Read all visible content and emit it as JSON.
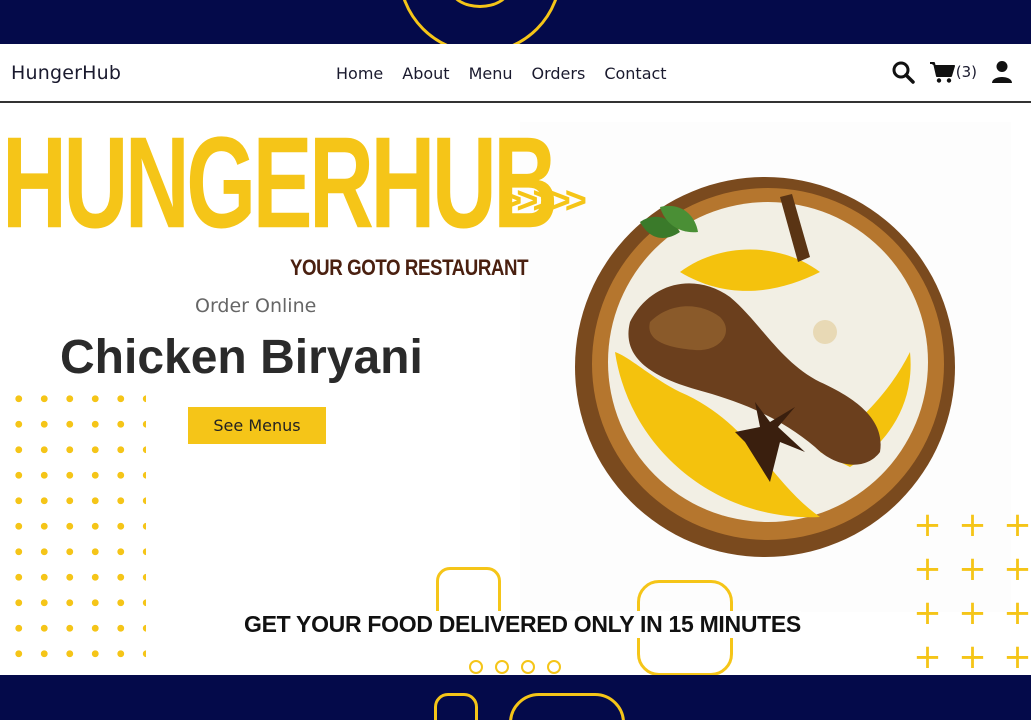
{
  "brand": "HungerHub",
  "nav": {
    "home": "Home",
    "about": "About",
    "menu": "Menu",
    "orders": "Orders",
    "contact": "Contact"
  },
  "header_icons": {
    "search": "search-icon",
    "cart": "cart-icon",
    "user": "user-icon",
    "cart_count": "(3)"
  },
  "hero": {
    "title": "HUNGERHUB",
    "arrows": ">>>>>",
    "tagline": "YOUR GOTO RESTAURANT",
    "subtitle": "Order Online",
    "dish": "Chicken Biryani",
    "cta": "See Menus"
  },
  "delivery_banner": "GET YOUR FOOD DELIVERED ONLY IN 15 MINUTES",
  "carousel": {
    "count": 4
  },
  "colors": {
    "accent": "#f5c518",
    "navy": "#040a4a",
    "tagline": "#4a2010",
    "text": "#2a2a2a"
  }
}
